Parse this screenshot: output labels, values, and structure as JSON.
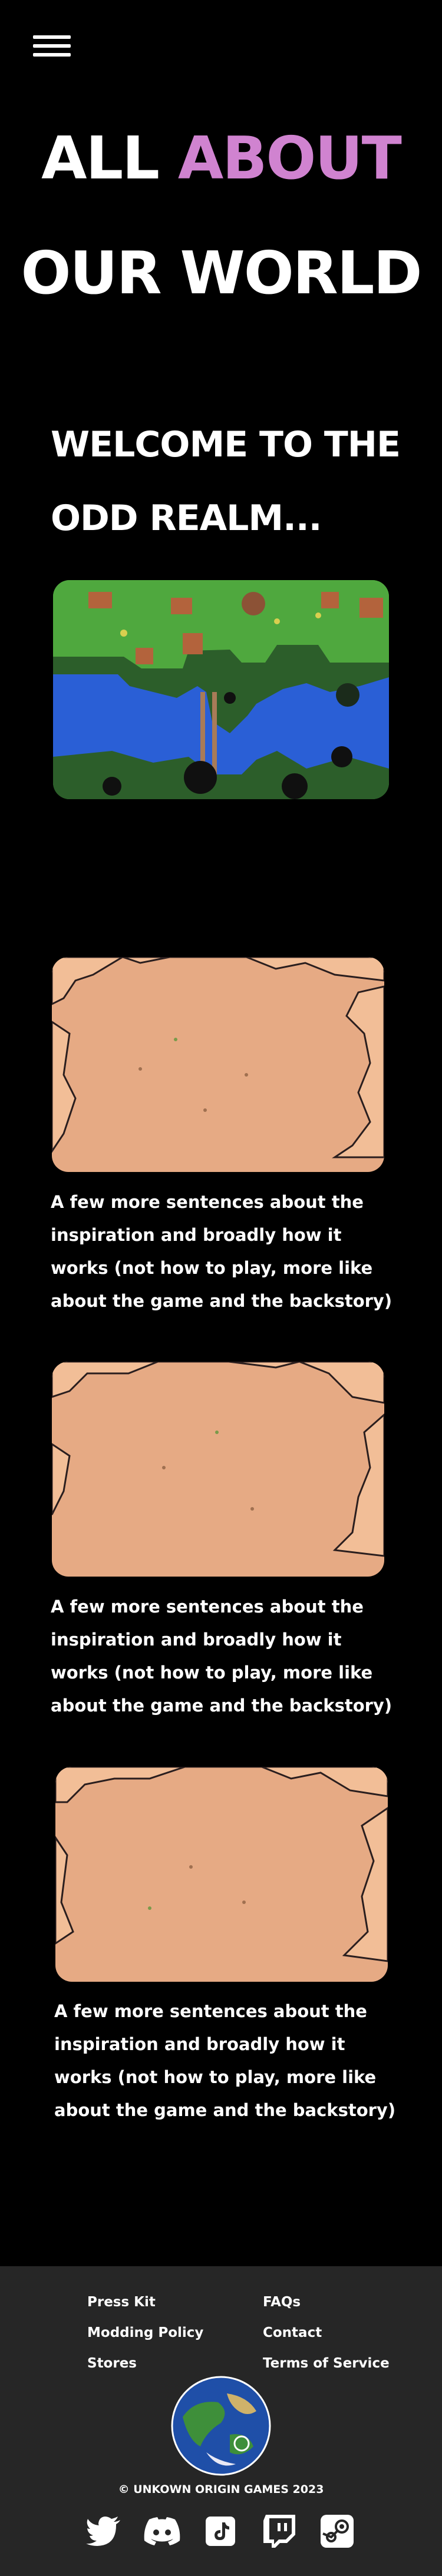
{
  "nav": {
    "menu_icon": "hamburger-menu-icon"
  },
  "hero": {
    "line1_white": "ALL",
    "line1_accent": "ABOUT",
    "line2": "OUR WORLD",
    "accent_color": "#d083d0"
  },
  "welcome": {
    "line1": "WELCOME TO THE",
    "line2": "ODD REALM..."
  },
  "sections": [
    {
      "text": "A few more sentences about the inspiration and broadly how it works (not how to play, more like about the game and the backstory)"
    },
    {
      "text": "A few more sentences about the inspiration and broadly how it works (not how to play, more like about the game and the backstory)"
    },
    {
      "text": "A few more sentences about the inspiration and broadly how it works (not how to play, more like about the game and the backstory)"
    }
  ],
  "footer": {
    "links_left": [
      "Press Kit",
      "Modding Policy",
      "Stores"
    ],
    "links_right": [
      "FAQs",
      "Contact",
      "Terms of Service"
    ],
    "copyright": "© UNKOWN ORIGIN GAMES 2023",
    "social_icons": [
      "twitter-icon",
      "discord-icon",
      "tiktok-icon",
      "twitch-icon",
      "steam-icon"
    ]
  }
}
